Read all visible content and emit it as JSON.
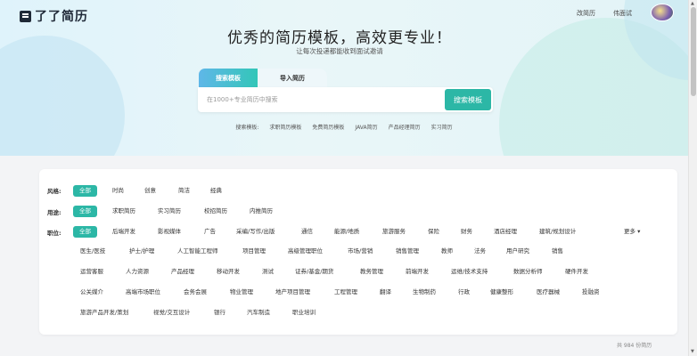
{
  "header": {
    "logo_text": "了了简历",
    "nav": [
      "改简历",
      "伟面试"
    ]
  },
  "hero": {
    "title": "优秀的简历模板，高效更专业！",
    "subtitle": "让每次投递都能收到面试邀请",
    "tabs": [
      {
        "label": "搜索模板",
        "active": true
      },
      {
        "label": "导入简历",
        "active": false
      }
    ],
    "search": {
      "placeholder": "在1000+专业简历中搜索",
      "value": "",
      "button": "搜索模板"
    },
    "hot_links": [
      "搜索模板:",
      "求职简历模板",
      "免费简历模板",
      "JAVA简历",
      "产品经理简历",
      "实习简历"
    ]
  },
  "filters": {
    "style": {
      "label": "风格:",
      "options": [
        "全部",
        "时尚",
        "创意",
        "简洁",
        "经典"
      ]
    },
    "usage": {
      "label": "用途:",
      "options": [
        "全部",
        "求职简历",
        "实习简历",
        "校招简历",
        "内推简历"
      ]
    },
    "job": {
      "label": "职位:",
      "more": "更多",
      "rows": [
        [
          "全部",
          "后端开发",
          "影视媒体",
          "广告",
          "采编/写作/出版",
          "通信",
          "能源/地质",
          "旅游服务",
          "保险",
          "财务",
          "酒店经理",
          "建筑/规划设计"
        ],
        [
          "医生/医技",
          "护士/护理",
          "人工智能工程师",
          "项目管理",
          "高级管理职位",
          "市场/营销",
          "销售管理",
          "教师",
          "法务",
          "用户研究",
          "销售"
        ],
        [
          "运营客服",
          "人力资源",
          "产品经理",
          "移动开发",
          "测试",
          "证券/基金/期货",
          "教务管理",
          "前端开发",
          "运维/技术支持",
          "数据分析师",
          "硬件开发"
        ],
        [
          "公关媒介",
          "高端市场职位",
          "会务会展",
          "物业管理",
          "地产项目管理",
          "工程管理",
          "翻译",
          "生物制药",
          "行政",
          "健康整形",
          "医疗器械",
          "投融资"
        ],
        [
          "旅游产品开发/策划",
          "视觉/交互设计",
          "银行",
          "汽车制造",
          "职业培训"
        ]
      ]
    }
  },
  "footer": {
    "count_text": "共 984 份简历"
  },
  "colors": {
    "accent": "#2cb7a6",
    "hero_bg": "#e3f4f7",
    "page_bg": "#f3f4f6"
  }
}
